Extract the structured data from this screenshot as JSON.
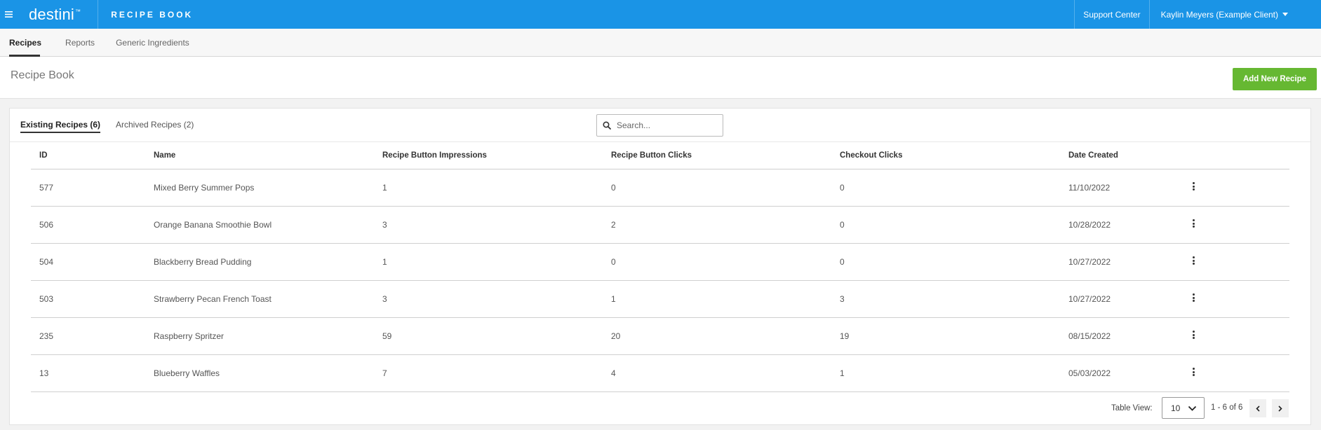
{
  "topbar": {
    "logo": "destini",
    "logo_tm": "™",
    "app_title": "RECIPE BOOK",
    "support_label": "Support Center",
    "user_label": "Kaylin Meyers (Example Client)"
  },
  "subnav": {
    "tabs": [
      {
        "label": "Recipes",
        "active": true
      },
      {
        "label": "Reports",
        "active": false
      },
      {
        "label": "Generic Ingredients",
        "active": false
      }
    ]
  },
  "page": {
    "title": "Recipe Book",
    "add_button": "Add New Recipe"
  },
  "card": {
    "tab_existing": "Existing Recipes (6)",
    "tab_archived": "Archived Recipes (2)",
    "search_placeholder": "Search..."
  },
  "table": {
    "headers": {
      "id": "ID",
      "name": "Name",
      "impressions": "Recipe Button Impressions",
      "clicks": "Recipe Button Clicks",
      "checkout": "Checkout Clicks",
      "date": "Date Created"
    },
    "rows": [
      {
        "id": "577",
        "name": "Mixed Berry Summer Pops",
        "impressions": "1",
        "clicks": "0",
        "checkout": "0",
        "date": "11/10/2022"
      },
      {
        "id": "506",
        "name": "Orange Banana Smoothie Bowl",
        "impressions": "3",
        "clicks": "2",
        "checkout": "0",
        "date": "10/28/2022"
      },
      {
        "id": "504",
        "name": "Blackberry Bread Pudding",
        "impressions": "1",
        "clicks": "0",
        "checkout": "0",
        "date": "10/27/2022"
      },
      {
        "id": "503",
        "name": "Strawberry Pecan French Toast",
        "impressions": "3",
        "clicks": "1",
        "checkout": "3",
        "date": "10/27/2022"
      },
      {
        "id": "235",
        "name": "Raspberry Spritzer",
        "impressions": "59",
        "clicks": "20",
        "checkout": "19",
        "date": "08/15/2022"
      },
      {
        "id": "13",
        "name": "Blueberry Waffles",
        "impressions": "7",
        "clicks": "4",
        "checkout": "1",
        "date": "05/03/2022"
      }
    ]
  },
  "footer": {
    "table_view_label": "Table View:",
    "page_size": "10",
    "range": "1 - 6 of 6"
  },
  "icons": {
    "menu": "hamburger-icon",
    "search": "search-icon",
    "row_menu": "kebab-icon",
    "prev": "chevron-left-icon",
    "next": "chevron-right-icon"
  },
  "colors": {
    "topbar": "#1a94e6",
    "add_button": "#66b832"
  }
}
